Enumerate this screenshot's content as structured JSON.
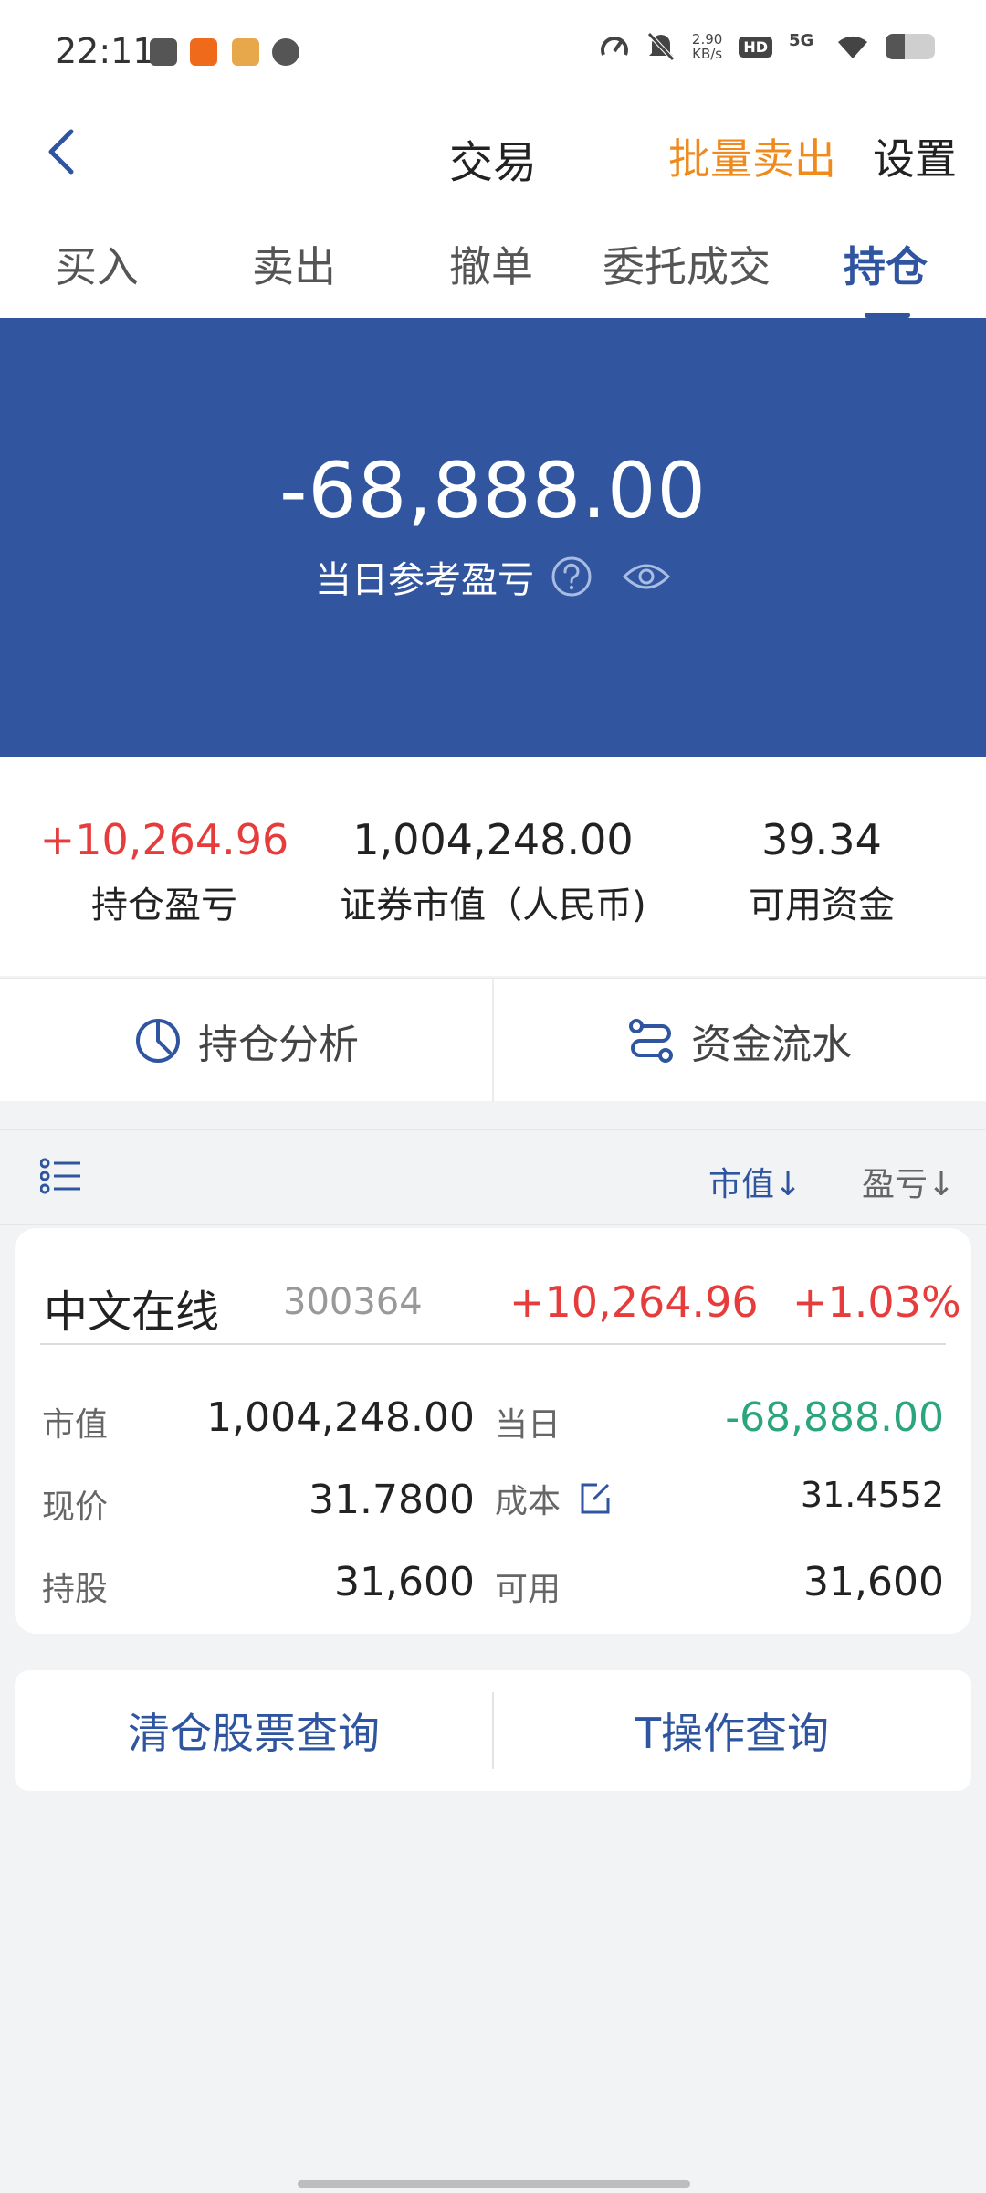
{
  "status_bar": {
    "time": "22:11",
    "speed_value": "2.90",
    "speed_unit": "KB/s",
    "hd": "HD",
    "network": "5G",
    "battery_level": 0.38
  },
  "nav": {
    "title": "交易",
    "batch_sell": "批量卖出",
    "settings": "设置"
  },
  "tabs": [
    {
      "label": "买入"
    },
    {
      "label": "卖出"
    },
    {
      "label": "撤单"
    },
    {
      "label": "委托成交"
    },
    {
      "label": "持仓",
      "active": true
    }
  ],
  "banner": {
    "amount": "-68,888.00",
    "label": "当日参考盈亏"
  },
  "summary": {
    "position_pl": {
      "value": "+10,264.96",
      "label": "持仓盈亏"
    },
    "market_value": {
      "value": "1,004,248.00",
      "label": "证券市值（人民币)"
    },
    "available": {
      "value": "39.34",
      "label": "可用资金"
    }
  },
  "analysis": {
    "position_analysis": "持仓分析",
    "fund_flow": "资金流水"
  },
  "list_header": {
    "sort_market_value": "市值↓",
    "sort_pl": "盈亏↓"
  },
  "position": {
    "name": "中文在线",
    "code": "300364",
    "pl": "+10,264.96",
    "pct": "+1.03%",
    "market_value_label": "市值",
    "market_value": "1,004,248.00",
    "today_label": "当日",
    "today": "-68,888.00",
    "price_label": "现价",
    "price": "31.7800",
    "cost_label": "成本",
    "cost": "31.4552",
    "shares_label": "持股",
    "shares": "31,600",
    "available_label": "可用",
    "available": "31,600"
  },
  "bottom": {
    "cleared_query": "清仓股票查询",
    "t_query": "T操作查询"
  },
  "colors": {
    "brand_blue": "#31569f",
    "accent_orange": "#f08a1c",
    "gain_red": "#e63c3c",
    "loss_green": "#2aa57d"
  }
}
